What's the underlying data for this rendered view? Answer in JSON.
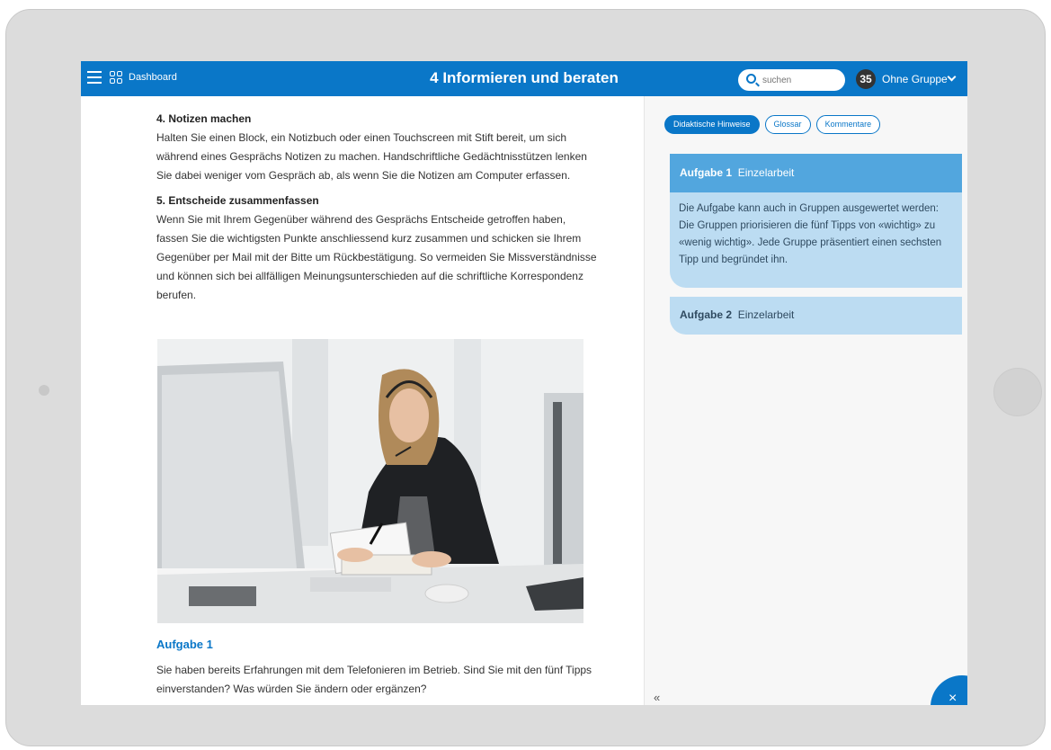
{
  "header": {
    "dashboard_label": "Dashboard",
    "title": "4 Informieren und beraten",
    "search_placeholder": "suchen",
    "group_count": "35",
    "group_label": "Ohne Gruppe"
  },
  "main": {
    "section4_title": "4. Notizen machen",
    "section4_text": "Halten Sie einen Block, ein Notizbuch oder einen Touchscreen mit Stift bereit, um sich während eines Gesprächs Notizen zu machen. Handschriftliche Gedächtnisstützen lenken Sie dabei weniger vom Gespräch ab, als wenn Sie die Notizen am Computer erfassen.",
    "section5_title": "5. Entscheide zusammenfassen",
    "section5_text": "Wenn Sie mit Ihrem Gegenüber während des Gesprächs Entscheide getroffen haben, fassen Sie die wichtigsten Punkte anschliessend kurz zusammen und schicken sie Ihrem Gegenüber per Mail mit der Bitte um Rückbestätigung. So vermeiden Sie Missverständnisse und können sich bei allfälligen Meinungsunterschieden auf die schriftliche Korrespondenz berufen.",
    "aufgabe_title": "Aufgabe 1",
    "aufgabe_text": "Sie haben bereits Erfahrungen mit dem Telefonieren im Betrieb. Sind Sie mit den fünf Tipps einverstanden? Was würden Sie ändern oder ergänzen?"
  },
  "sidebar": {
    "tabs": [
      "Didaktische Hinweise",
      "Glossar",
      "Kommentare"
    ],
    "card1": {
      "label": "Aufgabe 1",
      "type": "Einzelarbeit",
      "text": "Die Aufgabe kann auch in Gruppen ausgewertet werden: Die Gruppen priorisieren die fünf Tipps von «wichtig» zu «wenig wichtig». Jede Gruppe präsentiert einen sechsten Tipp und begründet ihn."
    },
    "card2": {
      "label": "Aufgabe 2",
      "type": "Einzelarbeit"
    },
    "collapse": "«",
    "close": "×"
  },
  "colors": {
    "primary": "#0a77c8",
    "card_header": "#52a6de",
    "card_body": "#bcdcf2"
  }
}
